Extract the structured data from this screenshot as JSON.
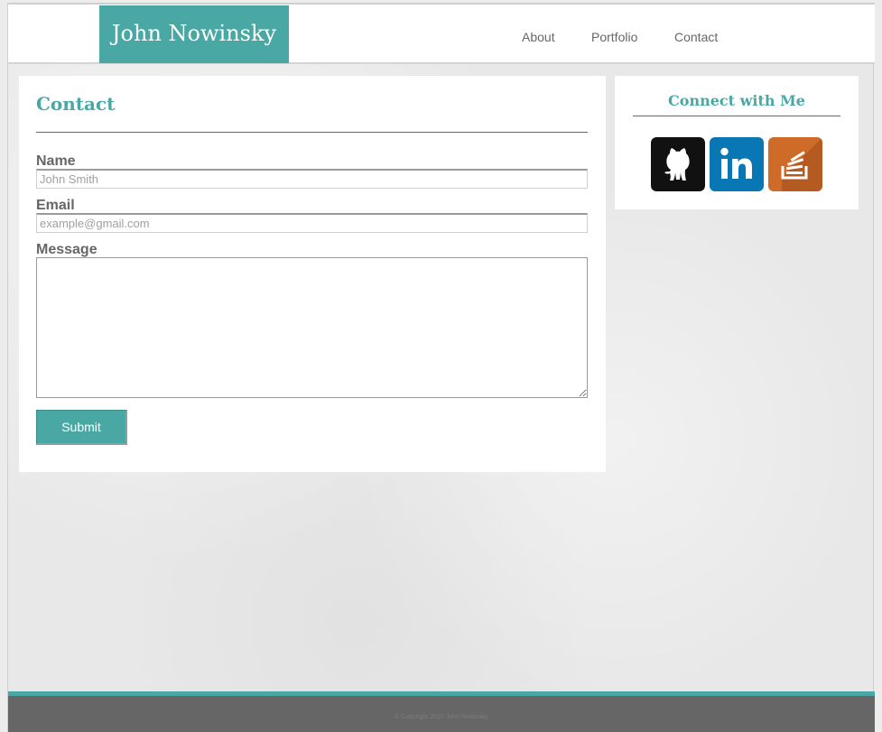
{
  "header": {
    "brand": "John Nowinsky",
    "nav": [
      "About",
      "Portfolio",
      "Contact"
    ]
  },
  "contact": {
    "title": "Contact",
    "name_label": "Name",
    "name_placeholder": "John Smith",
    "email_label": "Email",
    "email_placeholder": "example@gmail.com",
    "message_label": "Message",
    "submit_label": "Submit"
  },
  "connect": {
    "title": "Connect with Me",
    "icons": [
      {
        "name": "github-icon",
        "color": "#111111"
      },
      {
        "name": "linkedin-icon",
        "color": "#0a77b5"
      },
      {
        "name": "stackoverflow-icon",
        "color": "#cf6b29"
      }
    ]
  },
  "footer": {
    "text": "© Copyright 2015 John Nowinsky"
  },
  "colors": {
    "accent": "#4aa8a4",
    "text": "#666666",
    "footer": "#666666"
  }
}
